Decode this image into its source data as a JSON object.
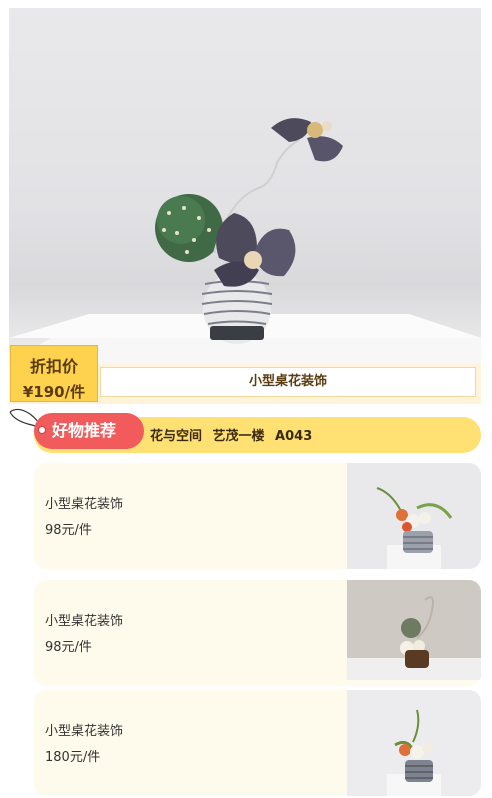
{
  "hero": {
    "image_alt": "flower-arrangement-photo",
    "price_label": "折扣价",
    "price_value": "¥190/件",
    "title": "小型桌花装饰"
  },
  "recommend": {
    "badge": "好物推荐",
    "location": "花与空间  艺茂一楼  A043"
  },
  "products": [
    {
      "name": "小型桌花装饰",
      "price": "98元/件"
    },
    {
      "name": "小型桌花装饰",
      "price": "98元/件"
    },
    {
      "name": "小型桌花装饰",
      "price": "180元/件"
    }
  ],
  "colors": {
    "badge": "#f15b5b",
    "bar": "#ffe073",
    "price_box": "#ffd24d",
    "card_bg": "#fffbec"
  }
}
